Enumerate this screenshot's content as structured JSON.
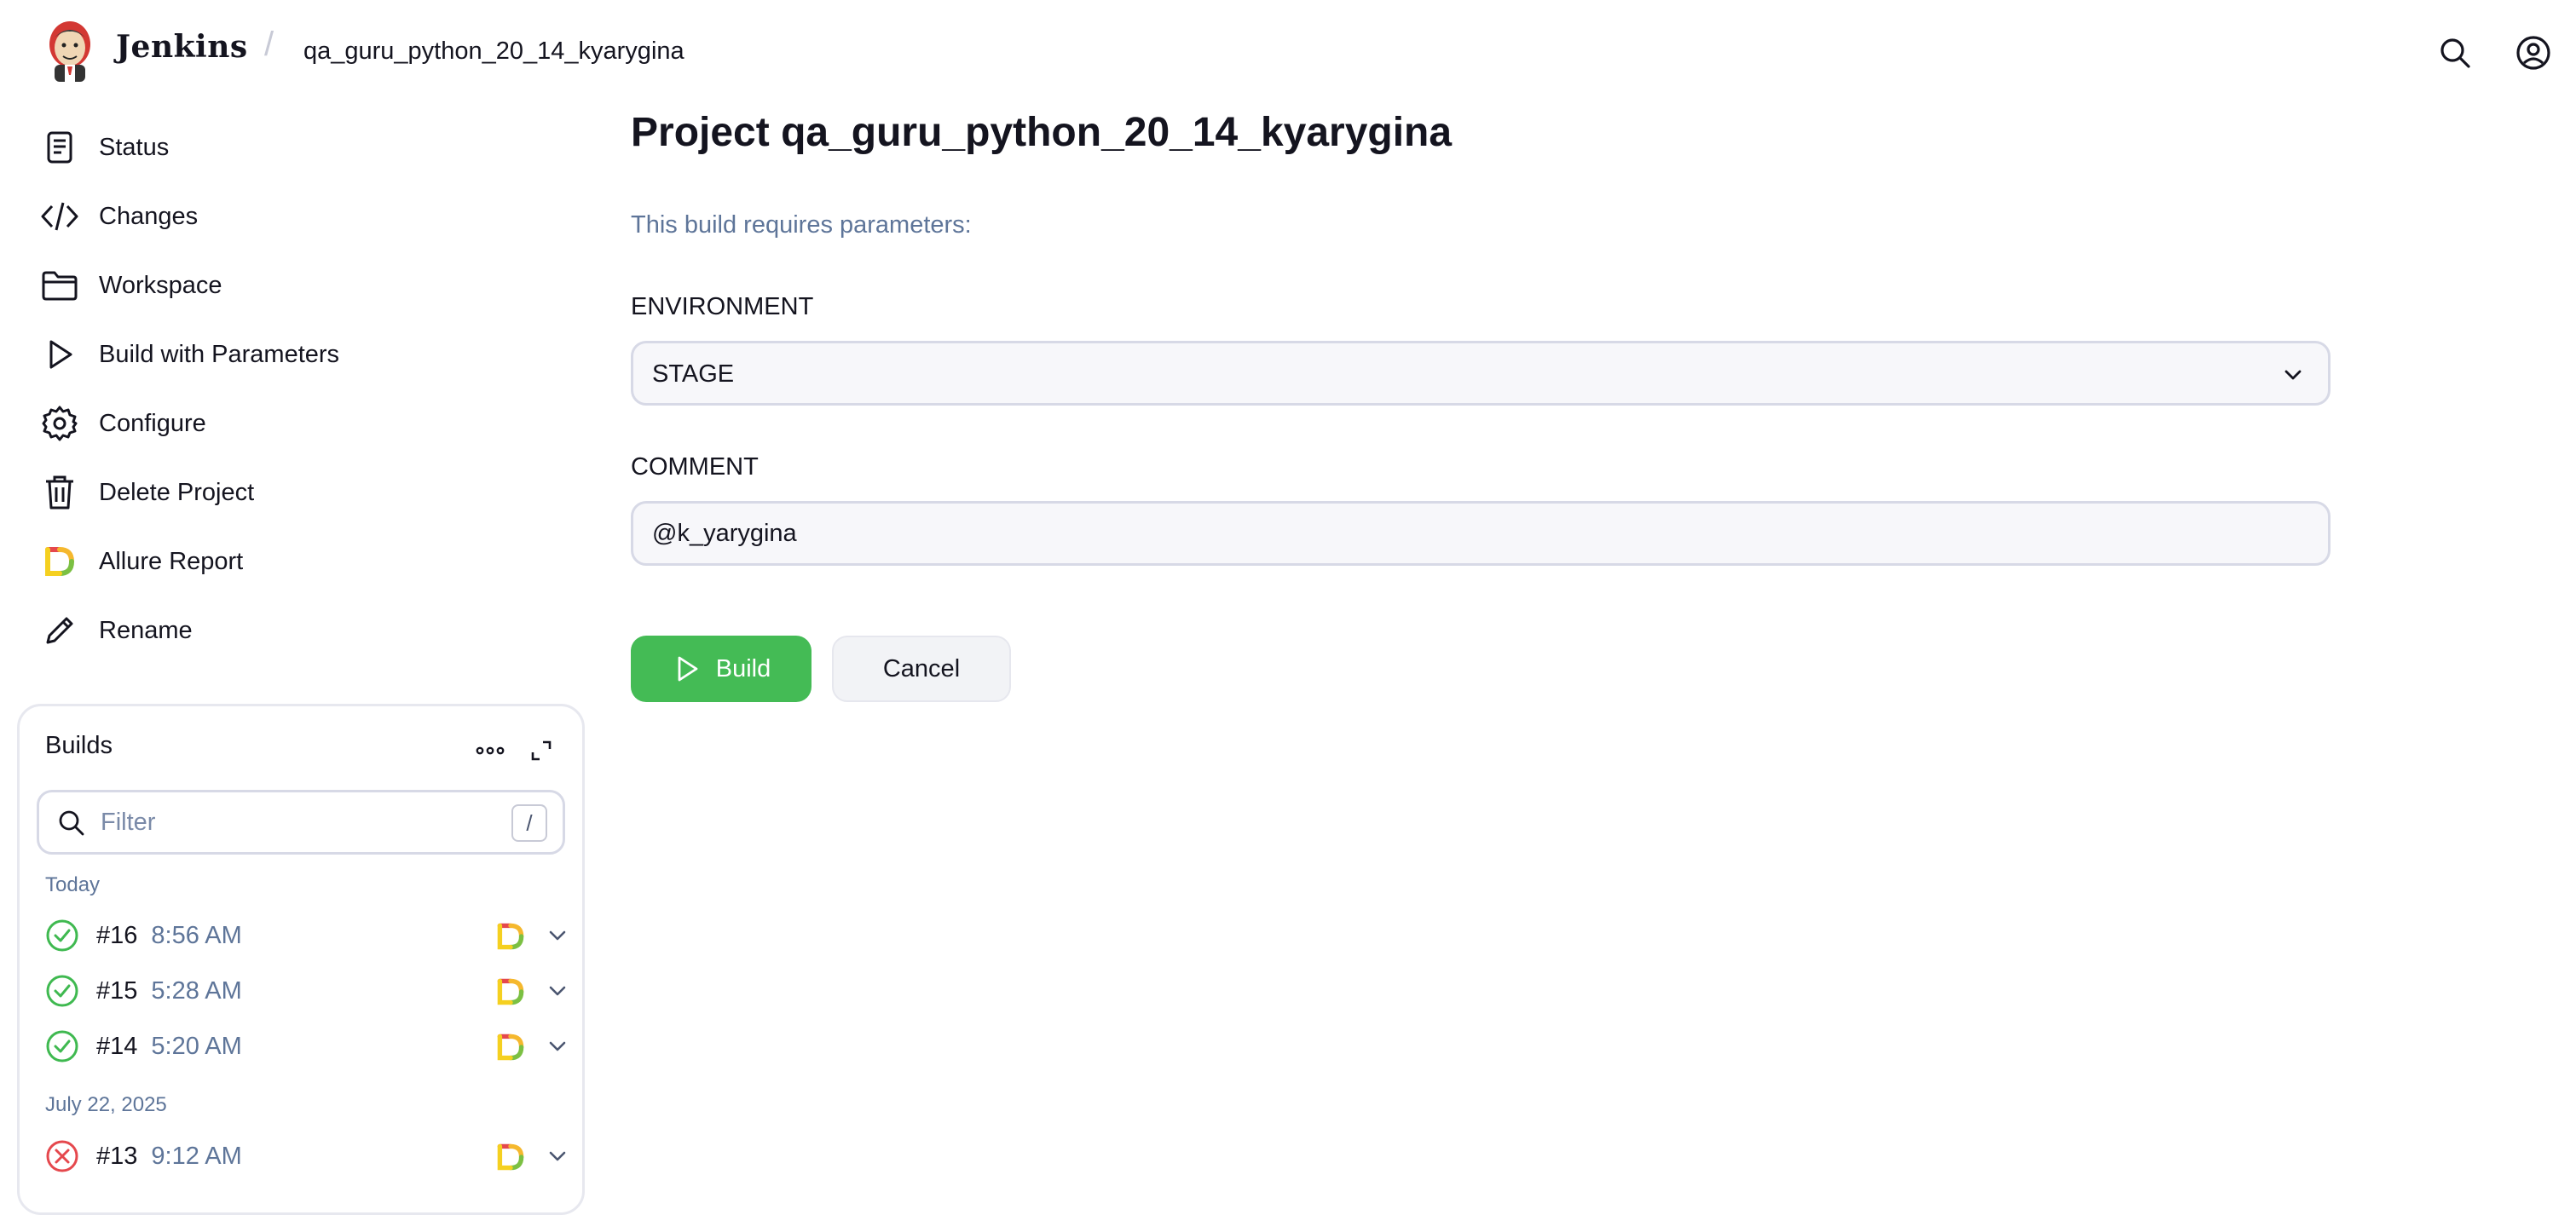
{
  "header": {
    "brand": "Jenkins",
    "separator": "/",
    "breadcrumb": "qa_guru_python_20_14_kyarygina",
    "icons": [
      "search-icon",
      "user-icon"
    ]
  },
  "sidebar": {
    "items": [
      {
        "label": "Status",
        "icon": "document-icon"
      },
      {
        "label": "Changes",
        "icon": "code-icon"
      },
      {
        "label": "Workspace",
        "icon": "folder-icon"
      },
      {
        "label": "Build with Parameters",
        "icon": "play-icon"
      },
      {
        "label": "Configure",
        "icon": "gear-icon"
      },
      {
        "label": "Delete Project",
        "icon": "trash-icon"
      },
      {
        "label": "Allure Report",
        "icon": "allure-icon"
      },
      {
        "label": "Rename",
        "icon": "pencil-icon"
      }
    ]
  },
  "builds": {
    "title": "Builds",
    "filter_placeholder": "Filter",
    "filter_shortcut": "/",
    "groups": [
      {
        "label": "Today",
        "rows": [
          {
            "number": "#16",
            "time": "8:56 AM",
            "status": "success"
          },
          {
            "number": "#15",
            "time": "5:28 AM",
            "status": "success"
          },
          {
            "number": "#14",
            "time": "5:20 AM",
            "status": "success"
          }
        ]
      },
      {
        "label": "July 22, 2025",
        "rows": [
          {
            "number": "#13",
            "time": "9:12 AM",
            "status": "failed"
          }
        ]
      }
    ]
  },
  "main": {
    "title": "Project qa_guru_python_20_14_kyarygina",
    "subtitle": "This build requires parameters:",
    "environment": {
      "label": "ENVIRONMENT",
      "value": "STAGE"
    },
    "comment": {
      "label": "COMMENT",
      "value": "@k_yarygina"
    },
    "build_label": "Build",
    "cancel_label": "Cancel"
  },
  "colors": {
    "accent_green": "#44bb55",
    "success": "#3fb950",
    "failure": "#e5484d",
    "muted_text": "#5e7599",
    "border": "#d7d9e6"
  }
}
